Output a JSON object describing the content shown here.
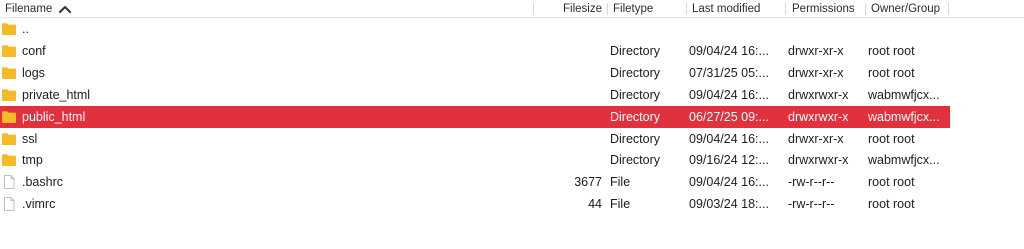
{
  "columns": {
    "filename": "Filename",
    "filesize": "Filesize",
    "filetype": "Filetype",
    "last_modified": "Last modified",
    "permissions": "Permissions",
    "owner_group": "Owner/Group"
  },
  "sort": {
    "column": "filename",
    "direction": "ascending",
    "icon": "chevron-up-icon"
  },
  "rows": [
    {
      "icon": "folder-icon",
      "name": "..",
      "size": "",
      "type": "",
      "modified": "",
      "permissions": "",
      "owner": "",
      "selected": false
    },
    {
      "icon": "folder-icon",
      "name": "conf",
      "size": "",
      "type": "Directory",
      "modified": "09/04/24 16:...",
      "permissions": "drwxr-xr-x",
      "owner": "root root",
      "selected": false
    },
    {
      "icon": "folder-icon",
      "name": "logs",
      "size": "",
      "type": "Directory",
      "modified": "07/31/25 05:...",
      "permissions": "drwxr-xr-x",
      "owner": "root root",
      "selected": false
    },
    {
      "icon": "folder-icon",
      "name": "private_html",
      "size": "",
      "type": "Directory",
      "modified": "09/04/24 16:...",
      "permissions": "drwxrwxr-x",
      "owner": "wabmwfjcx...",
      "selected": false
    },
    {
      "icon": "folder-icon",
      "name": "public_html",
      "size": "",
      "type": "Directory",
      "modified": "06/27/25 09:...",
      "permissions": "drwxrwxr-x",
      "owner": "wabmwfjcx...",
      "selected": true
    },
    {
      "icon": "folder-icon",
      "name": "ssl",
      "size": "",
      "type": "Directory",
      "modified": "09/04/24 16:...",
      "permissions": "drwxr-xr-x",
      "owner": "root root",
      "selected": false
    },
    {
      "icon": "folder-icon",
      "name": "tmp",
      "size": "",
      "type": "Directory",
      "modified": "09/16/24 12:...",
      "permissions": "drwxrwxr-x",
      "owner": "wabmwfjcx...",
      "selected": false
    },
    {
      "icon": "file-icon",
      "name": ".bashrc",
      "size": "3677",
      "type": "File",
      "modified": "09/04/24 16:...",
      "permissions": "-rw-r--r--",
      "owner": "root root",
      "selected": false
    },
    {
      "icon": "file-icon",
      "name": ".vimrc",
      "size": "44",
      "type": "File",
      "modified": "09/03/24 18:...",
      "permissions": "-rw-r--r--",
      "owner": "root root",
      "selected": false
    }
  ],
  "colors": {
    "selection": "#e0313d",
    "folder": "#f6b928"
  }
}
